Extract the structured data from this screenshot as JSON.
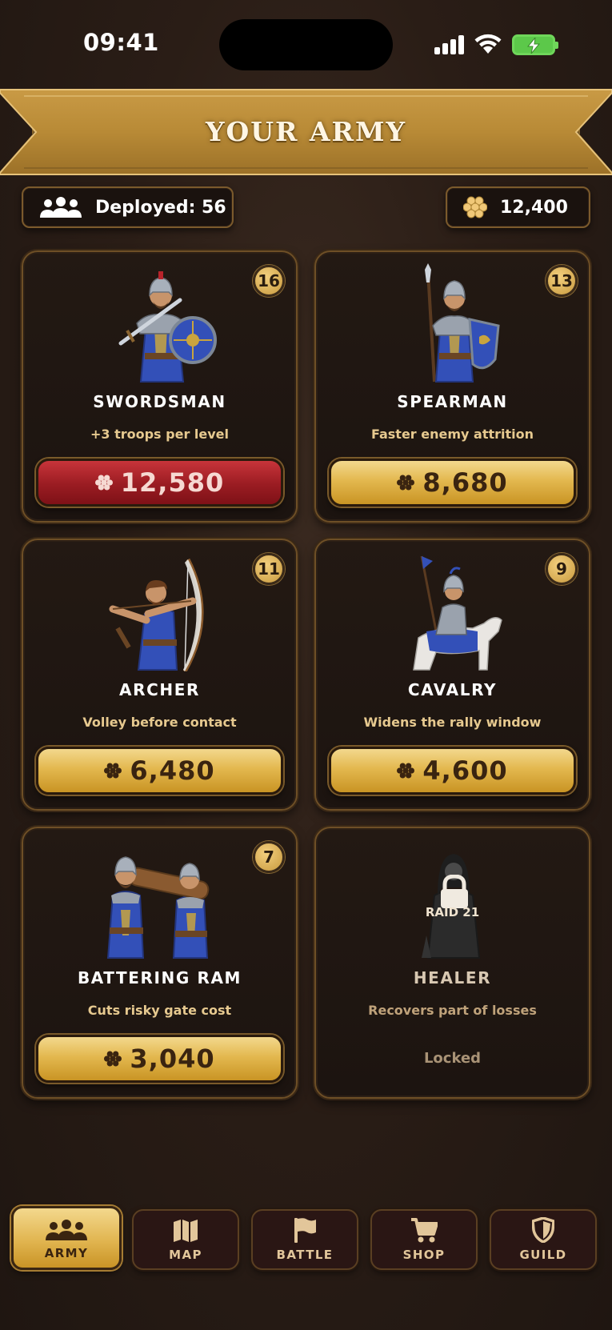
{
  "status_bar": {
    "time": "09:41"
  },
  "header": {
    "title": "YOUR ARMY"
  },
  "stats": {
    "deployed_label": "Deployed: 56",
    "gold_amount": "12,400"
  },
  "units": [
    {
      "name": "SWORDSMAN",
      "level": "16",
      "description": "+3 troops per level",
      "cost": "12,580",
      "cost_state": "unaffordable",
      "portrait": "swordsman-portrait"
    },
    {
      "name": "SPEARMAN",
      "level": "13",
      "description": "Faster enemy attrition",
      "cost": "8,680",
      "cost_state": "affordable",
      "portrait": "spearman-portrait"
    },
    {
      "name": "ARCHER",
      "level": "11",
      "description": "Volley before contact",
      "cost": "6,480",
      "cost_state": "affordable",
      "portrait": "archer-portrait"
    },
    {
      "name": "CAVALRY",
      "level": "9",
      "description": "Widens the rally window",
      "cost": "4,600",
      "cost_state": "affordable",
      "portrait": "cavalry-portrait"
    },
    {
      "name": "BATTERING RAM",
      "level": "7",
      "description": "Cuts risky gate cost",
      "cost": "3,040",
      "cost_state": "affordable",
      "portrait": "battering-ram-portrait"
    },
    {
      "name": "HEALER",
      "description": "Recovers part of losses",
      "unlock_requirement": "RAID 21",
      "status": "Locked",
      "portrait": "healer-portrait"
    }
  ],
  "nav": {
    "items": [
      {
        "label": "ARMY",
        "icon": "army-icon",
        "active": true
      },
      {
        "label": "MAP",
        "icon": "map-icon"
      },
      {
        "label": "BATTLE",
        "icon": "flag-icon"
      },
      {
        "label": "SHOP",
        "icon": "cart-icon"
      },
      {
        "label": "GUILD",
        "icon": "shield-icon"
      }
    ]
  },
  "colors": {
    "background": "#2a1d16",
    "gold": "#e3b84f",
    "red_button": "#9a1c22",
    "card_border": "#6e4f26",
    "accent_text": "#e6c98f",
    "blue_tabard": "#3350b8"
  }
}
